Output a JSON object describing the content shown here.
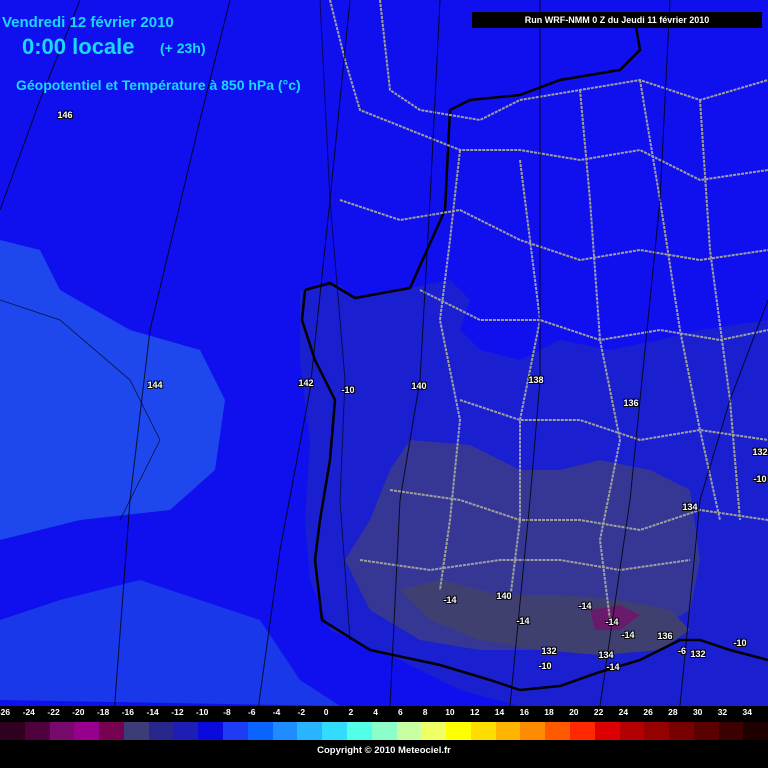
{
  "header": {
    "date": "Vendredi 12 février 2010",
    "time": "0:00 locale",
    "lead": "(+ 23h)",
    "variable": "Géopotentiel et Température à 850 hPa (°c)",
    "run": "Run WRF-NMM 0 Z du Jeudi 11 février 2010"
  },
  "contour_labels": [
    {
      "text": "146",
      "kind": "height"
    },
    {
      "text": "144",
      "kind": "height"
    },
    {
      "text": "142",
      "kind": "height"
    },
    {
      "text": "-10",
      "kind": "temp"
    },
    {
      "text": "140",
      "kind": "height"
    },
    {
      "text": "138",
      "kind": "height"
    },
    {
      "text": "136",
      "kind": "height"
    },
    {
      "text": "134",
      "kind": "height"
    },
    {
      "text": "132",
      "kind": "height"
    },
    {
      "text": "-10",
      "kind": "temp"
    },
    {
      "text": "-14",
      "kind": "temp"
    },
    {
      "text": "140",
      "kind": "height"
    },
    {
      "text": "-14",
      "kind": "temp"
    },
    {
      "text": "-14",
      "kind": "temp"
    },
    {
      "text": "-14",
      "kind": "temp"
    },
    {
      "text": "-14",
      "kind": "temp"
    },
    {
      "text": "136",
      "kind": "height"
    },
    {
      "text": "132",
      "kind": "height"
    },
    {
      "text": "-10",
      "kind": "temp"
    },
    {
      "text": "134",
      "kind": "height"
    },
    {
      "text": "-14",
      "kind": "temp"
    },
    {
      "text": "-6",
      "kind": "temp"
    },
    {
      "text": "132",
      "kind": "height"
    },
    {
      "text": "-10",
      "kind": "temp"
    },
    {
      "text": "132",
      "kind": "height"
    }
  ],
  "legend": {
    "ticks": [
      "-26",
      "-24",
      "-22",
      "-20",
      "-18",
      "-16",
      "-14",
      "-12",
      "-10",
      "-8",
      "-6",
      "-4",
      "-2",
      "0",
      "2",
      "4",
      "6",
      "8",
      "10",
      "12",
      "14",
      "16",
      "18",
      "20",
      "22",
      "24",
      "26",
      "28",
      "30",
      "32",
      "34"
    ],
    "colors": [
      "#300020",
      "#50003c",
      "#780a6e",
      "#96008c",
      "#780050",
      "#3c3c78",
      "#28288c",
      "#1e1eb4",
      "#0a0ade",
      "#1e3cf5",
      "#0a64ff",
      "#1e8cff",
      "#28b4ff",
      "#32dcff",
      "#50ffe6",
      "#8cffc8",
      "#c8ffa0",
      "#f0ff64",
      "#ffff00",
      "#ffdc00",
      "#ffb400",
      "#ff8c00",
      "#ff5a00",
      "#ff2800",
      "#dc0000",
      "#b40000",
      "#960000",
      "#780000",
      "#5a0000",
      "#3c0000",
      "#1e0000"
    ]
  },
  "credit": "Copyright © 2010 Meteociel.fr"
}
